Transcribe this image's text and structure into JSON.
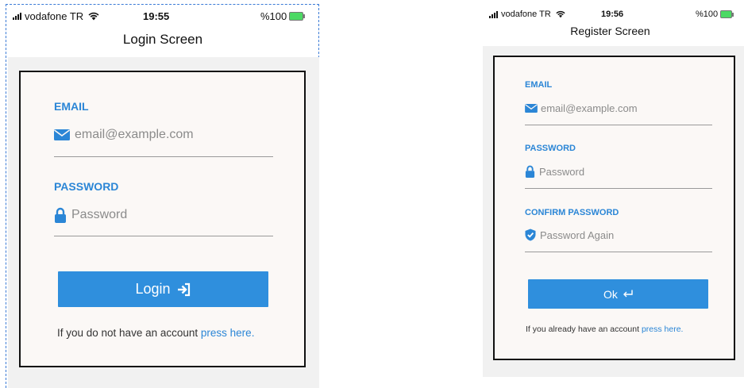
{
  "login": {
    "status": {
      "carrier": "vodafone TR",
      "time": "19:55",
      "battery": "%100"
    },
    "title": "Login Screen",
    "email_label": "EMAIL",
    "email_placeholder": "email@example.com",
    "password_label": "PASSWORD",
    "password_placeholder": "Password",
    "button_label": "Login",
    "footer_text": "If you do not have an account",
    "footer_link": "press here."
  },
  "register": {
    "status": {
      "carrier": "vodafone TR",
      "time": "19:56",
      "battery": "%100"
    },
    "title": "Register Screen",
    "email_label": "EMAIL",
    "email_placeholder": "email@example.com",
    "password_label": "PASSWORD",
    "password_placeholder": "Password",
    "confirm_label": "CONFIRM PASSWORD",
    "confirm_placeholder": "Password Again",
    "button_label": "Ok",
    "footer_text": "If you already have an account",
    "footer_link": "press here."
  },
  "colors": {
    "accent": "#2b86d6",
    "button": "#2f8fdd",
    "card_bg": "#fbf8f6",
    "page_bg": "#f1f1f1"
  },
  "icons": [
    "signal-icon",
    "wifi-icon",
    "battery-icon",
    "envelope-icon",
    "lock-icon",
    "shield-check-icon",
    "sign-in-icon",
    "return-arrow-icon"
  ]
}
